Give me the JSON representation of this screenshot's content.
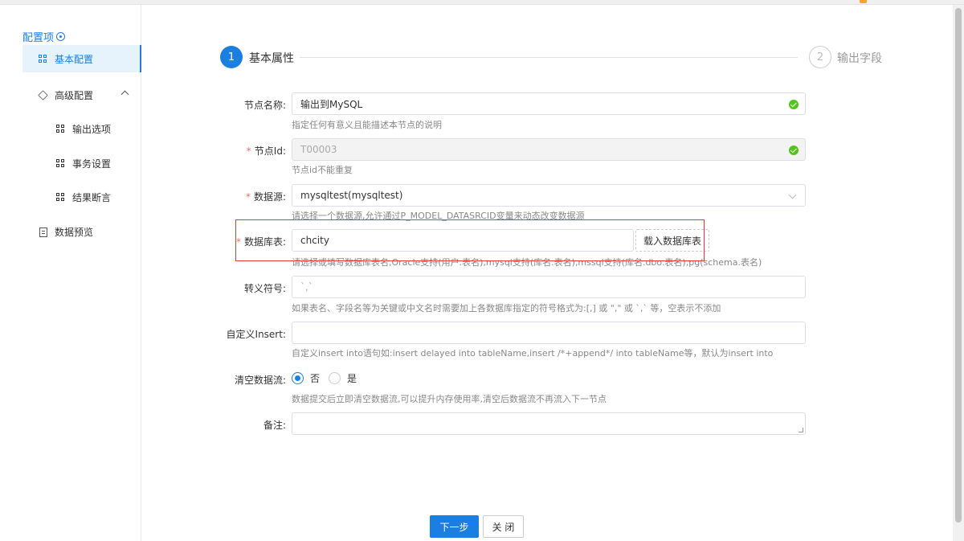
{
  "sidebar": {
    "title": "配置项",
    "items": [
      {
        "label": "基本配置",
        "icon": "grid-icon",
        "active": true
      },
      {
        "label": "高级配置",
        "icon": "cube-icon",
        "expanded": true
      },
      {
        "label": "输出选项",
        "icon": "grid-icon"
      },
      {
        "label": "事务设置",
        "icon": "grid-icon"
      },
      {
        "label": "结果断言",
        "icon": "grid-icon"
      },
      {
        "label": "数据预览",
        "icon": "doc-icon"
      }
    ]
  },
  "steps": [
    {
      "number": "1",
      "label": "基本属性",
      "active": true
    },
    {
      "number": "2",
      "label": "输出字段",
      "active": false
    }
  ],
  "form": {
    "node_name": {
      "label": "节点名称:",
      "value": "输出到MySQL",
      "hint": "指定任何有意义且能描述本节点的说明"
    },
    "node_id": {
      "label": "节点Id:",
      "value": "T00003",
      "hint": "节点id不能重复"
    },
    "datasource": {
      "label": "数据源:",
      "value": "mysqltest(mysqltest)",
      "hint": "请选择一个数据源,允许通过P_MODEL_DATASRCID变量来动态改变数据源"
    },
    "table": {
      "label": "数据库表:",
      "value": "chcity",
      "button": "载入数据库表",
      "hint": "请选择或填写数据库表名,Oracle支持(用户.表名),mysql支持(库名.表名),mssql支持(库名.dbo.表名),pg(schema.表名)"
    },
    "escape": {
      "label": "转义符号:",
      "placeholder": "`,`",
      "hint": "如果表名、字段名等为关键或中文名时需要加上各数据库指定的符号格式为:[,] 或 \",\" 或 `,` 等，空表示不添加"
    },
    "custom_insert": {
      "label": "自定义Insert:",
      "value": "",
      "hint": "自定义insert into语句如:insert delayed into tableName,insert /*+append*/ into tableName等，默认为insert into"
    },
    "clear_stream": {
      "label": "清空数据流:",
      "options": [
        "否",
        "是"
      ],
      "selected": "否",
      "hint": "数据提交后立即清空数据流,可以提升内存使用率,清空后数据流不再流入下一节点"
    },
    "remark": {
      "label": "备注:",
      "value": ""
    }
  },
  "buttons": {
    "next": "下一步",
    "close": "关 闭"
  },
  "colors": {
    "primary": "#1a7fe0",
    "required": "#f56c6c",
    "success": "#52c41a",
    "highlight": "#e3393c"
  }
}
